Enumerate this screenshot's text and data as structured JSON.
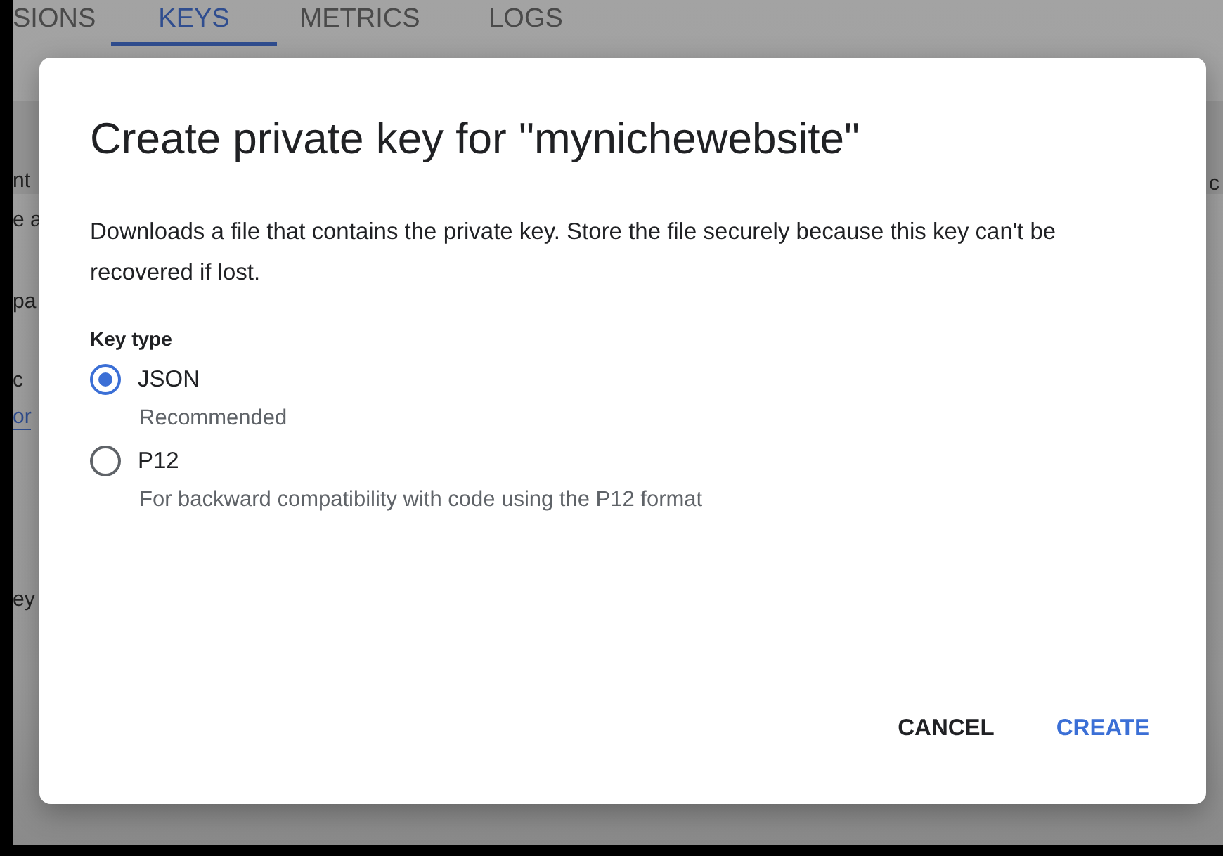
{
  "background": {
    "tabs": [
      {
        "label": "SIONS",
        "selected": false
      },
      {
        "label": "KEYS",
        "selected": true
      },
      {
        "label": "METRICS",
        "selected": false
      },
      {
        "label": "LOGS",
        "selected": false
      }
    ],
    "left_fragments": [
      "nt",
      "e a",
      "pa",
      "c",
      "or",
      "ey"
    ],
    "right_fragments": [
      "c"
    ]
  },
  "dialog": {
    "title": "Create private key for \"mynichewebsite\"",
    "description": "Downloads a file that contains the private key. Store the file securely because this key can't be recovered if lost.",
    "key_type": {
      "label": "Key type",
      "options": [
        {
          "label": "JSON",
          "hint": "Recommended",
          "selected": true
        },
        {
          "label": "P12",
          "hint": "For backward compatibility with code using the P12 format",
          "selected": false
        }
      ]
    },
    "buttons": [
      {
        "label": "CANCEL",
        "kind": "secondary"
      },
      {
        "label": "CREATE",
        "kind": "primary"
      }
    ]
  }
}
